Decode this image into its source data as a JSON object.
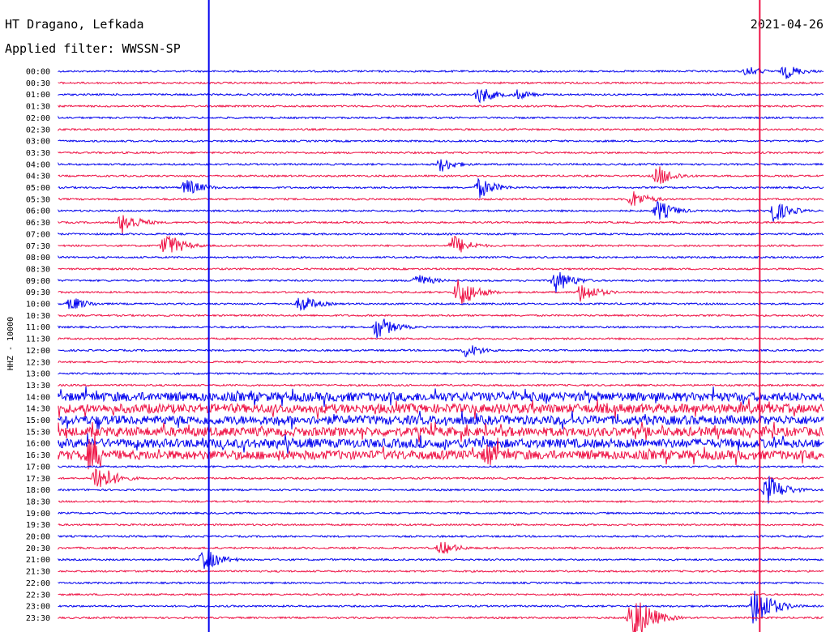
{
  "chart_data": {
    "type": "line",
    "title": "HT Dragano, Lefkada",
    "date": "2021-04-26",
    "subtitle": "Applied filter: WWSSN-SP",
    "ylabel": "HHZ - 10000",
    "rows": [
      "00:00",
      "00:30",
      "01:00",
      "01:30",
      "02:00",
      "02:30",
      "03:00",
      "03:30",
      "04:00",
      "04:30",
      "05:00",
      "05:30",
      "06:00",
      "06:30",
      "07:00",
      "07:30",
      "08:00",
      "08:30",
      "09:00",
      "09:30",
      "10:00",
      "10:30",
      "11:00",
      "11:30",
      "12:00",
      "12:30",
      "13:00",
      "13:30",
      "14:00",
      "14:30",
      "15:00",
      "15:30",
      "16:00",
      "16:30",
      "17:00",
      "17:30",
      "18:00",
      "18:30",
      "19:00",
      "19:30",
      "20:00",
      "20:30",
      "21:00",
      "21:30",
      "22:00",
      "22:30",
      "23:00",
      "23:30"
    ],
    "colors": {
      "even": "#0000ee",
      "odd": "#ee1144"
    },
    "events": [
      {
        "row": 0,
        "minute": 27,
        "amp": 7
      },
      {
        "row": 0,
        "minute": 28.5,
        "amp": 10
      },
      {
        "row": 2,
        "minute": 18,
        "amp": 7
      },
      {
        "row": 2,
        "minute": 16.5,
        "amp": 12
      },
      {
        "row": 8,
        "minute": 15,
        "amp": 10
      },
      {
        "row": 9,
        "minute": 23.5,
        "amp": 14
      },
      {
        "row": 10,
        "minute": 5,
        "amp": 12
      },
      {
        "row": 10,
        "minute": 16.5,
        "amp": 14
      },
      {
        "row": 11,
        "minute": 22.5,
        "amp": 12
      },
      {
        "row": 12,
        "minute": 23.5,
        "amp": 14
      },
      {
        "row": 12,
        "minute": 28,
        "amp": 16
      },
      {
        "row": 13,
        "minute": 2.5,
        "amp": 16
      },
      {
        "row": 15,
        "minute": 4.2,
        "amp": 18
      },
      {
        "row": 15,
        "minute": 15.5,
        "amp": 14
      },
      {
        "row": 18,
        "minute": 14,
        "amp": 10
      },
      {
        "row": 18,
        "minute": 19.5,
        "amp": 16
      },
      {
        "row": 19,
        "minute": 15.7,
        "amp": 22
      },
      {
        "row": 19,
        "minute": 20.5,
        "amp": 14
      },
      {
        "row": 20,
        "minute": 0.5,
        "amp": 10
      },
      {
        "row": 20,
        "minute": 9.5,
        "amp": 12
      },
      {
        "row": 22,
        "minute": 12.5,
        "amp": 16
      },
      {
        "row": 24,
        "minute": 16,
        "amp": 10
      },
      {
        "row": 32,
        "minute": 16,
        "amp": 10
      },
      {
        "row": 33,
        "minute": 1.2,
        "amp": 20
      },
      {
        "row": 33,
        "minute": 16.8,
        "amp": 18
      },
      {
        "row": 35,
        "minute": 1.5,
        "amp": 22
      },
      {
        "row": 36,
        "minute": 27.8,
        "amp": 20
      },
      {
        "row": 41,
        "minute": 15,
        "amp": 10
      },
      {
        "row": 42,
        "minute": 5.7,
        "amp": 16
      },
      {
        "row": 47,
        "minute": 22.5,
        "amp": 40
      },
      {
        "row": 46,
        "minute": 27.3,
        "amp": 30
      }
    ],
    "noisy_rows": [
      28,
      29,
      30,
      31,
      32,
      33
    ],
    "markers": [
      {
        "minute": 5.9,
        "color": "#0000ee"
      },
      {
        "minute": 27.5,
        "color": "#ee1144"
      }
    ]
  }
}
